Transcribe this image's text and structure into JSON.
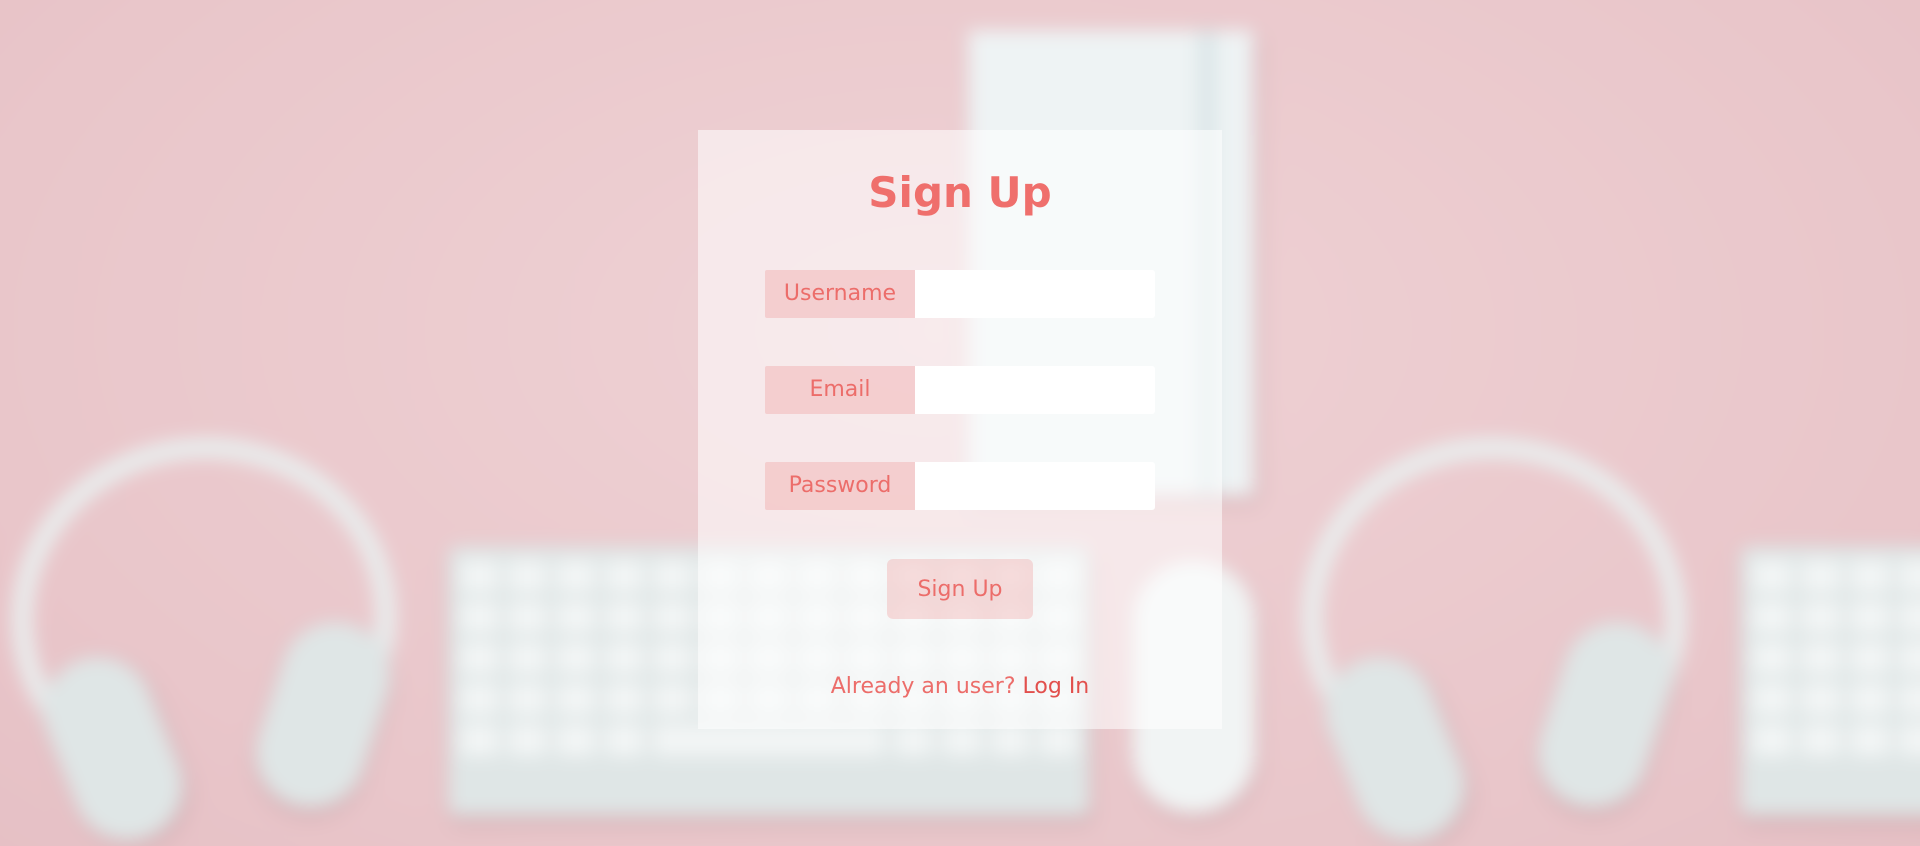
{
  "colors": {
    "accent": "#ef6f6c",
    "link": "#e2504d",
    "background": "#ebc9cd",
    "card": "rgba(255,255,255,0.55)"
  },
  "background_image": {
    "icons": [
      "headphones-icon",
      "keyboard-icon",
      "notebook-icon",
      "mouse-icon"
    ]
  },
  "form": {
    "title": "Sign Up",
    "fields": [
      {
        "label": "Username",
        "value": "",
        "placeholder": ""
      },
      {
        "label": "Email",
        "value": "",
        "placeholder": ""
      },
      {
        "label": "Password",
        "value": "",
        "placeholder": ""
      }
    ],
    "submit_label": "Sign Up",
    "footer_text": "Already an user?",
    "footer_link": "Log In"
  }
}
